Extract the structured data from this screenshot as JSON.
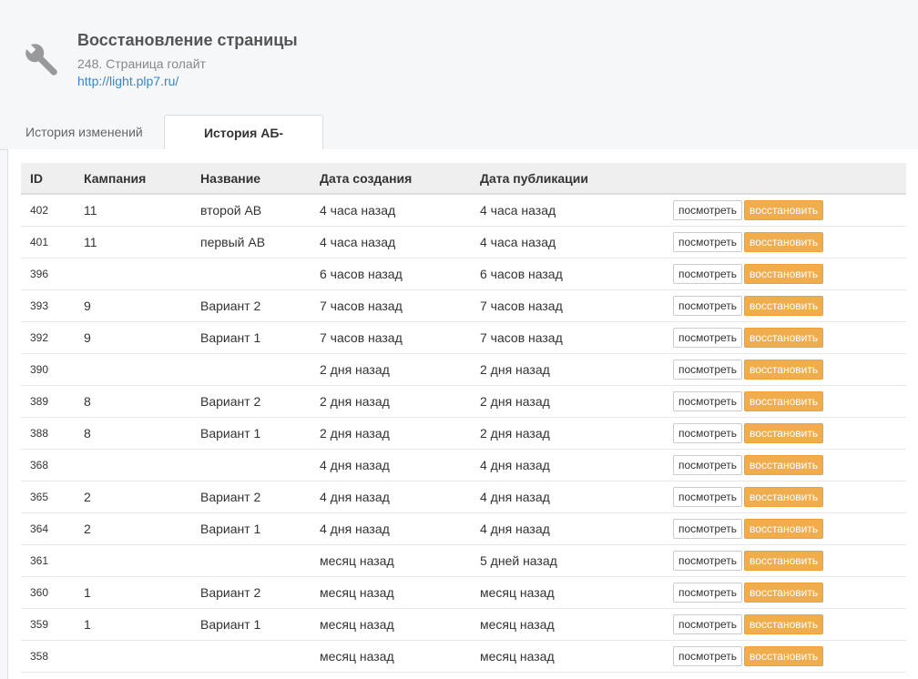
{
  "header": {
    "title": "Восстановление страницы",
    "subtitle": "248. Страница голайт",
    "link": "http://light.plp7.ru/"
  },
  "tabs": [
    {
      "label": "История изменений",
      "active": false
    },
    {
      "label": "История АБ-тестов",
      "active": true
    }
  ],
  "table": {
    "columns": [
      "ID",
      "Кампания",
      "Название",
      "Дата создания",
      "Дата публикации",
      ""
    ],
    "view_label": "посмотреть",
    "restore_label": "восстановить",
    "rows": [
      {
        "id": "402",
        "campaign": "11",
        "name": "второй АВ",
        "created": "4 часа назад",
        "published": "4 часа назад"
      },
      {
        "id": "401",
        "campaign": "11",
        "name": "первый АВ",
        "created": "4 часа назад",
        "published": "4 часа назад"
      },
      {
        "id": "396",
        "campaign": "",
        "name": "",
        "created": "6 часов назад",
        "published": "6 часов назад"
      },
      {
        "id": "393",
        "campaign": "9",
        "name": "Вариант 2",
        "created": "7 часов назад",
        "published": "7 часов назад"
      },
      {
        "id": "392",
        "campaign": "9",
        "name": "Вариант 1",
        "created": "7 часов назад",
        "published": "7 часов назад"
      },
      {
        "id": "390",
        "campaign": "",
        "name": "",
        "created": "2 дня назад",
        "published": "2 дня назад"
      },
      {
        "id": "389",
        "campaign": "8",
        "name": "Вариант 2",
        "created": "2 дня назад",
        "published": "2 дня назад"
      },
      {
        "id": "388",
        "campaign": "8",
        "name": "Вариант 1",
        "created": "2 дня назад",
        "published": "2 дня назад"
      },
      {
        "id": "368",
        "campaign": "",
        "name": "",
        "created": "4 дня назад",
        "published": "4 дня назад"
      },
      {
        "id": "365",
        "campaign": "2",
        "name": "Вариант 2",
        "created": "4 дня назад",
        "published": "4 дня назад"
      },
      {
        "id": "364",
        "campaign": "2",
        "name": "Вариант 1",
        "created": "4 дня назад",
        "published": "4 дня назад"
      },
      {
        "id": "361",
        "campaign": "",
        "name": "",
        "created": "месяц назад",
        "published": "5 дней назад"
      },
      {
        "id": "360",
        "campaign": "1",
        "name": "Вариант 2",
        "created": "месяц назад",
        "published": "месяц назад"
      },
      {
        "id": "359",
        "campaign": "1",
        "name": "Вариант 1",
        "created": "месяц назад",
        "published": "месяц назад"
      },
      {
        "id": "358",
        "campaign": "",
        "name": "",
        "created": "месяц назад",
        "published": "месяц назад"
      }
    ]
  },
  "colors": {
    "accent": "#f0ad4e",
    "link": "#3a86c8",
    "page_bg": "#f5f7f8"
  },
  "icons": {
    "header_icon": "wrench-icon"
  }
}
